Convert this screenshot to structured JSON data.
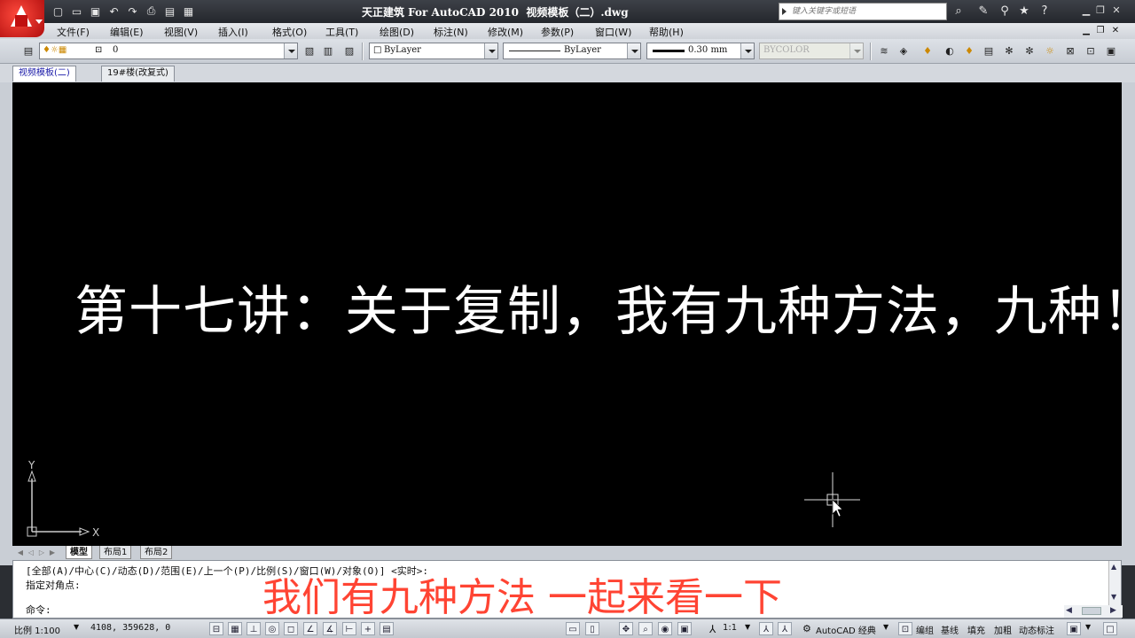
{
  "title_bar": {
    "title": "天正建筑 For AutoCAD 2010  视频模板（二）.dwg",
    "search_placeholder": "键入关键字或短语",
    "quick_access_icons": [
      "new-icon",
      "open-icon",
      "save-icon",
      "undo-icon",
      "redo-icon",
      "plot-icon",
      "publish-icon",
      "workspace-icon"
    ],
    "right_icons": [
      "binoculars-icon",
      "wrench-icon",
      "antenna-icon",
      "star-icon",
      "help-icon"
    ]
  },
  "menu": [
    {
      "label": "文件(F)"
    },
    {
      "label": "编辑(E)"
    },
    {
      "label": "视图(V)"
    },
    {
      "label": "插入(I)"
    },
    {
      "label": "格式(O)"
    },
    {
      "label": "工具(T)"
    },
    {
      "label": "绘图(D)"
    },
    {
      "label": "标注(N)"
    },
    {
      "label": "修改(M)"
    },
    {
      "label": "参数(P)"
    },
    {
      "label": "窗口(W)"
    },
    {
      "label": "帮助(H)"
    }
  ],
  "toolbar": {
    "layer_value": "0",
    "color_value": "ByLayer",
    "linetype_value": "ByLayer",
    "lineweight_value": "0.30 mm",
    "plotstyle_value": "BYCOLOR"
  },
  "doc_tabs": [
    {
      "label": "视频模板(二)"
    },
    {
      "label": "19#楼(改复式)"
    }
  ],
  "drawing": {
    "text": "第十七讲：关于复制，我有九种方法，九种！",
    "ucs_x": "X",
    "ucs_y": "Y"
  },
  "layout_tabs": [
    {
      "label": "模型"
    },
    {
      "label": "布局1"
    },
    {
      "label": "布局2"
    }
  ],
  "command": {
    "history_line": "[全部(A)/中心(C)/动态(D)/范围(E)/上一个(P)/比例(S)/窗口(W)/对象(O)] <实时>:",
    "prompt_line": "指定对角点:",
    "input_label": "命令:"
  },
  "subtitle": "我们有九种方法  一起来看一下",
  "status_bar": {
    "scale": "比例 1:100",
    "coords": "4108,  359628, 0",
    "anno_scale": "1:1",
    "workspace": "AutoCAD 经典",
    "buttons": [
      "编组",
      "基线",
      "填充",
      "加粗",
      "动态标注"
    ]
  },
  "colors": {
    "canvas": "#000000",
    "subtitle": "#ff4433",
    "logo": "#d01818"
  }
}
